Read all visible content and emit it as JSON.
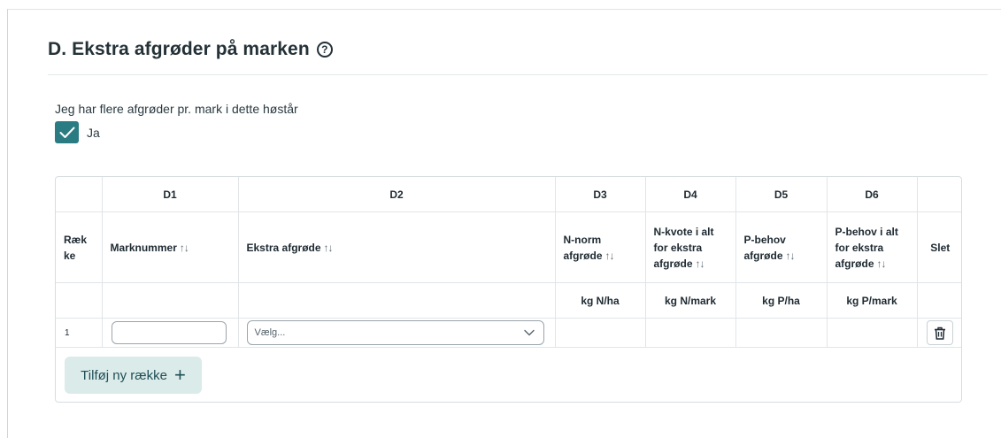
{
  "section": {
    "title": "D. Ekstra afgrøder på marken",
    "help_icon": "?"
  },
  "question": {
    "text": "Jeg har flere afgrøder pr. mark i dette høstår",
    "checkbox_label": "Ja",
    "checked": true
  },
  "table": {
    "groups": [
      "",
      "D1",
      "D2",
      "D3",
      "D4",
      "D5",
      "D6",
      ""
    ],
    "headers": [
      "Ræk\nke",
      "Marknummer",
      "Ekstra afgrøde",
      "N-norm\nafgrøde",
      "N-kvote i alt\nfor ekstra\nafgrøde",
      "P-behov\nafgrøde",
      "P-behov i alt\nfor ekstra\nafgrøde",
      "Slet"
    ],
    "sort_icon": "↑↓",
    "units": [
      "",
      "",
      "",
      "kg N/ha",
      "kg N/mark",
      "kg P/ha",
      "kg P/mark",
      ""
    ],
    "rows": [
      {
        "row_number": "1",
        "marknummer_value": "",
        "afgroede_placeholder": "Vælg...",
        "d3": "",
        "d4": "",
        "d5": "",
        "d6": ""
      }
    ]
  },
  "add_row_button": {
    "label": "Tilføj ny række",
    "icon": "+"
  },
  "colors": {
    "accent": "#2a7c82",
    "add_button_bg": "#dbebea"
  }
}
